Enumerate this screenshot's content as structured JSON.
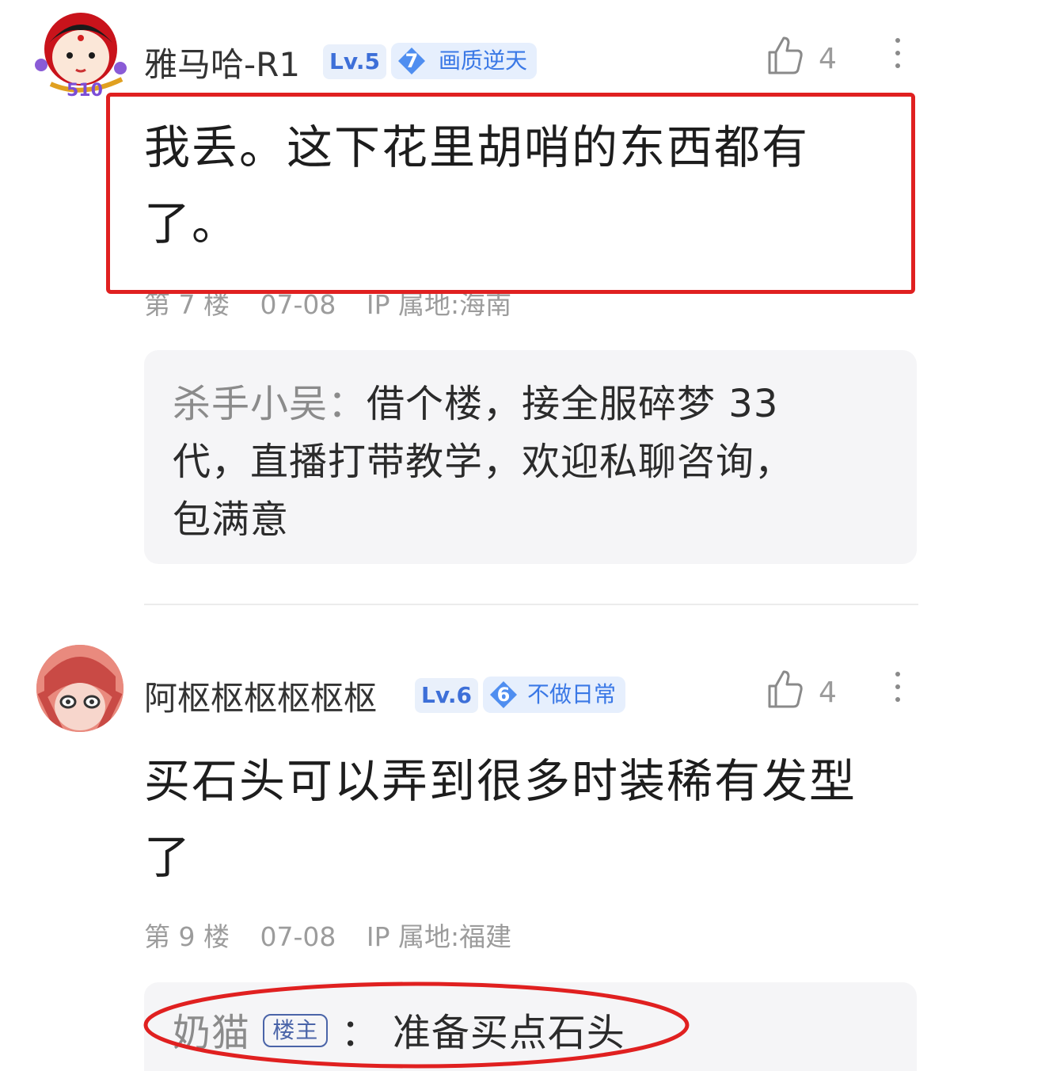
{
  "comments": [
    {
      "username": "雅马哈-R1",
      "level": "Lv.5",
      "badge_number": "7",
      "badge_label": "画质逆天",
      "likes": "4",
      "avatar_badge": "510",
      "text_line1": "我丢。这下花里胡哨的东西都有",
      "text_line2": "了。",
      "floor": "第 7 楼",
      "date": "07-08",
      "ip": "IP 属地:海南",
      "reply_author": "杀手小吴：",
      "reply_line1": "借个楼，接全服碎梦 33",
      "reply_line2": "代，直播打带教学，欢迎私聊咨询，",
      "reply_line3": "包满意"
    },
    {
      "username": "阿枢枢枢枢枢枢",
      "level": "Lv.6",
      "badge_number": "6",
      "badge_label": "不做日常",
      "likes": "4",
      "text_line1": "买石头可以弄到很多时装稀有发型",
      "text_line2": "了",
      "floor": "第 9 楼",
      "date": "07-08",
      "ip": "IP 属地:福建",
      "reply_author": "奶猫",
      "reply_tag": "楼主",
      "reply_colon": "：",
      "reply_text": "准备买点石头"
    }
  ],
  "colors": {
    "highlight_red": "#e02020",
    "badge_blue": "#3a78e6",
    "level_blue": "#3d6fd8"
  }
}
